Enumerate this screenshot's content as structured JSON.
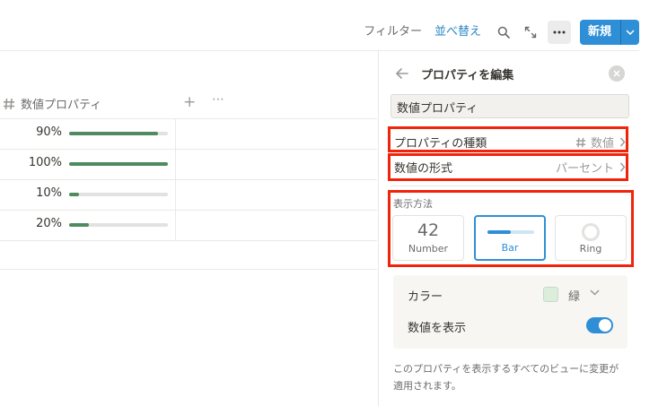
{
  "toolbar": {
    "filter_label": "フィルター",
    "sort_label": "並べ替え",
    "new_label": "新規",
    "icons": [
      "search-icon",
      "expand-icon",
      "more-icon",
      "chevron-down-icon"
    ]
  },
  "table": {
    "column_title": "数値プロパティ",
    "rows": [
      {
        "label": "90%",
        "value": 0.9
      },
      {
        "label": "100%",
        "value": 1.0
      },
      {
        "label": "10%",
        "value": 0.1
      },
      {
        "label": "20%",
        "value": 0.2
      }
    ]
  },
  "panel": {
    "title": "プロパティを編集",
    "name_value": "数値プロパティ",
    "prop_type_label": "プロパティの種類",
    "prop_type_value": "数値",
    "number_format_label": "数値の形式",
    "number_format_value": "パーセント",
    "display_section_label": "表示方法",
    "display_options": [
      {
        "preview": "42",
        "label": "Number"
      },
      {
        "preview": "",
        "label": "Bar"
      },
      {
        "preview": "",
        "label": "Ring"
      }
    ],
    "selected_option": "Bar",
    "color_label": "カラー",
    "color_value": "緑",
    "show_number_label": "数値を表示",
    "show_number_on": true,
    "footer_text": "このプロパティを表示するすべてのビューに変更が適用されます。"
  },
  "colors": {
    "accent": "#2e8fd6",
    "bar_fill": "#4f8b5f",
    "highlight": "#f0240b"
  }
}
